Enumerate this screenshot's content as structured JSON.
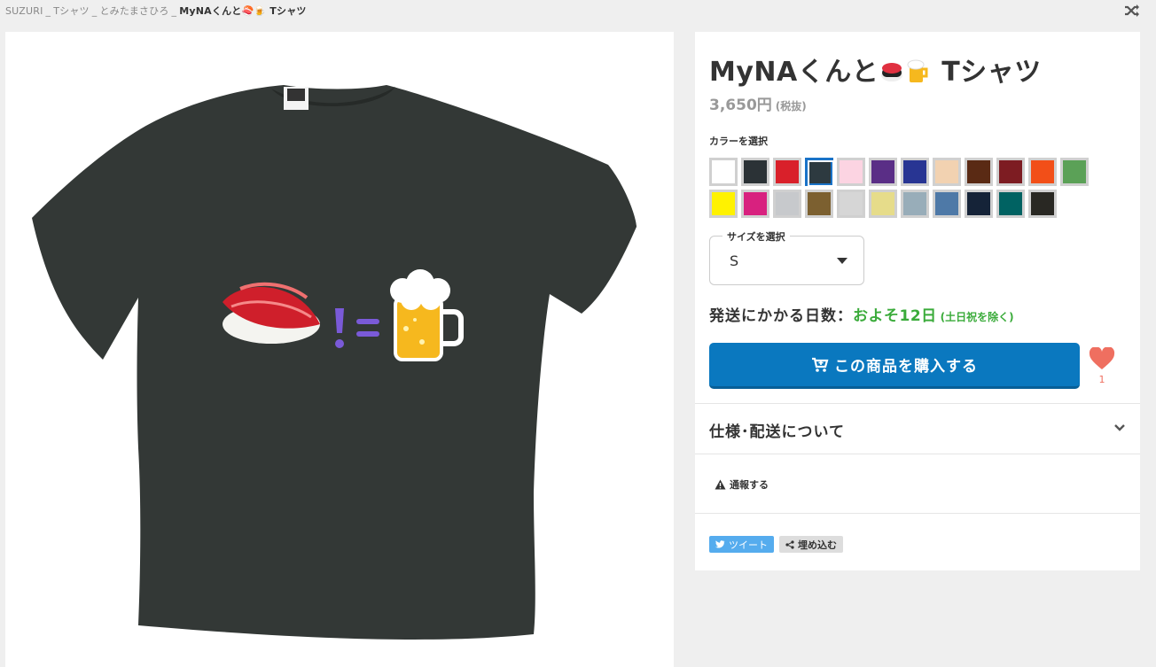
{
  "breadcrumb": {
    "items": [
      "SUZURI",
      "Tシャツ",
      "とみたまさひろ"
    ],
    "separator": "_",
    "current": "MyNAくんと🍣🍺 Tシャツ"
  },
  "product": {
    "title_text": "MyNAくんと",
    "title_suffix": "Tシャツ",
    "title_emoji_icons": [
      "sushi-icon",
      "beer-mug-icon"
    ],
    "price": "3,650円",
    "tax_note": "(税抜)"
  },
  "colors": {
    "label": "カラーを選択",
    "selected_index": 3,
    "swatches": [
      "#ffffff",
      "#2b3236",
      "#d9202a",
      "#2d3a40",
      "#fcd4e2",
      "#5a2e86",
      "#283593",
      "#f2d2b1",
      "#5a2a14",
      "#7d1c22",
      "#f24f18",
      "#5ba157",
      "#fff200",
      "#d8217f",
      "#c7c9cc",
      "#7c6030",
      "#d6d6d6",
      "#e6dc8a",
      "#98adb9",
      "#4e79a7",
      "#152338",
      "#006262",
      "#292823"
    ]
  },
  "size": {
    "label": "サイズを選択",
    "value": "S"
  },
  "shipping": {
    "label": "発送にかかる日数：",
    "days": "およそ12日",
    "note": "(土日祝を除く)"
  },
  "buy": {
    "label": "この商品を購入する"
  },
  "likes": {
    "count": "1"
  },
  "spec": {
    "label": "仕様･配送について"
  },
  "report": {
    "label": "通報する"
  },
  "share": {
    "tweet_label": "ツイート",
    "embed_label": "埋め込む"
  },
  "shirt": {
    "color": "#2d3a40"
  }
}
